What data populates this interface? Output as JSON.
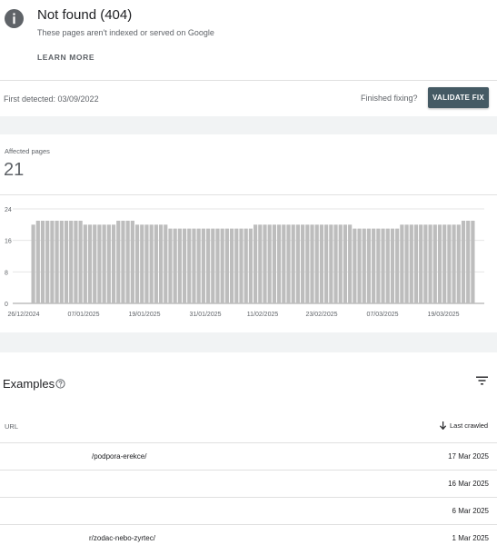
{
  "issue": {
    "title": "Not found (404)",
    "subtitle": "These pages aren't indexed or served on Google",
    "learn_more": "LEARN MORE",
    "first_detected": "First detected: 03/09/2022",
    "finished_fixing": "Finished fixing?",
    "validate_button": "VALIDATE FIX"
  },
  "affected": {
    "label": "Affected pages",
    "value": "21"
  },
  "chart_data": {
    "type": "bar",
    "color": "#bdbdbd",
    "ylim": [
      0,
      24
    ],
    "yticks": [
      0,
      8,
      16,
      24
    ],
    "xtick_labels": [
      "26/12/2024",
      "07/01/2025",
      "19/01/2025",
      "31/01/2025",
      "11/02/2025",
      "23/02/2025",
      "07/03/2025",
      "19/03/2025"
    ],
    "values": [
      20,
      21,
      21,
      21,
      21,
      21,
      21,
      21,
      21,
      21,
      21,
      20,
      20,
      20,
      20,
      20,
      20,
      20,
      21,
      21,
      21,
      21,
      20,
      20,
      20,
      20,
      20,
      20,
      20,
      19,
      19,
      19,
      19,
      19,
      19,
      19,
      19,
      19,
      19,
      19,
      19,
      19,
      19,
      19,
      19,
      19,
      19,
      20,
      20,
      20,
      20,
      20,
      20,
      20,
      20,
      20,
      20,
      20,
      20,
      20,
      20,
      20,
      20,
      20,
      20,
      20,
      20,
      20,
      19,
      19,
      19,
      19,
      19,
      19,
      19,
      19,
      19,
      19,
      20,
      20,
      20,
      20,
      20,
      20,
      20,
      20,
      20,
      20,
      20,
      20,
      20,
      21,
      21,
      21
    ]
  },
  "examples": {
    "title": "Examples",
    "url_header": "URL",
    "last_crawled_header": "Last crawled",
    "rows": [
      {
        "url": "/podpora-erekce/",
        "date": "17 Mar 2025"
      },
      {
        "url": "",
        "date": "16 Mar 2025"
      },
      {
        "url": "",
        "date": "6 Mar 2025"
      },
      {
        "url": "r/zodac-nebo-zyrtec/",
        "date": "1 Mar 2025"
      }
    ]
  }
}
